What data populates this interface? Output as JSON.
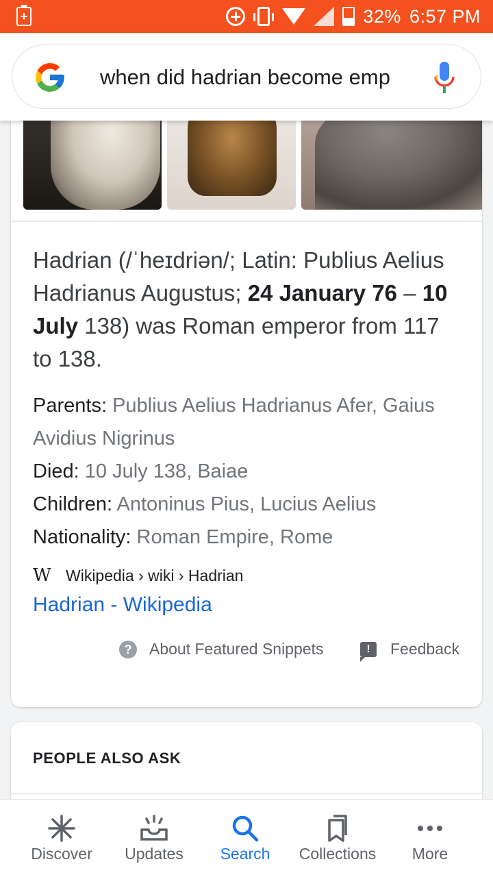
{
  "status_bar": {
    "battery_percent": "32%",
    "time": "6:57 PM"
  },
  "search": {
    "query": "when did hadrian become emp",
    "logo": "google-g-icon",
    "mic_icon": "mic-icon"
  },
  "knowledge_panel": {
    "images": [
      "bust-image-1",
      "bust-image-2",
      "bust-image-3"
    ],
    "snippet": {
      "part1": "Hadrian (/ˈheɪdriən/; Latin: Publius Aelius Hadrianus Augustus; ",
      "bold1": "24 January 76",
      "part2": " – ",
      "bold2": "10 July",
      "part3": " 138) was Roman emperor from 117 to 138."
    },
    "facts": [
      {
        "label": "Parents:",
        "value": "Publius Aelius Hadrianus Afer, Gaius Avidius Nigrinus"
      },
      {
        "label": "Died:",
        "value": "10 July 138, Baiae"
      },
      {
        "label": "Children:",
        "value": "Antoninus Pius, Lucius Aelius"
      },
      {
        "label": "Nationality:",
        "value": "Roman Empire, Rome"
      }
    ],
    "source": {
      "icon_text": "W",
      "breadcrumb": "Wikipedia › wiki › Hadrian"
    },
    "link_title": "Hadrian - Wikipedia",
    "about_label": "About Featured Snippets",
    "feedback_label": "Feedback"
  },
  "people_also_ask": {
    "heading": "PEOPLE ALSO ASK"
  },
  "bottom_nav": {
    "items": [
      {
        "label": "Discover",
        "icon": "asterisk-icon",
        "active": false
      },
      {
        "label": "Updates",
        "icon": "inbox-icon",
        "active": false
      },
      {
        "label": "Search",
        "icon": "search-icon",
        "active": true
      },
      {
        "label": "Collections",
        "icon": "bookmarks-icon",
        "active": false
      },
      {
        "label": "More",
        "icon": "more-dots-icon",
        "active": false
      }
    ]
  },
  "colors": {
    "status_bar": "#f4511e",
    "link": "#1967d2",
    "active_nav": "#1a73e8"
  }
}
